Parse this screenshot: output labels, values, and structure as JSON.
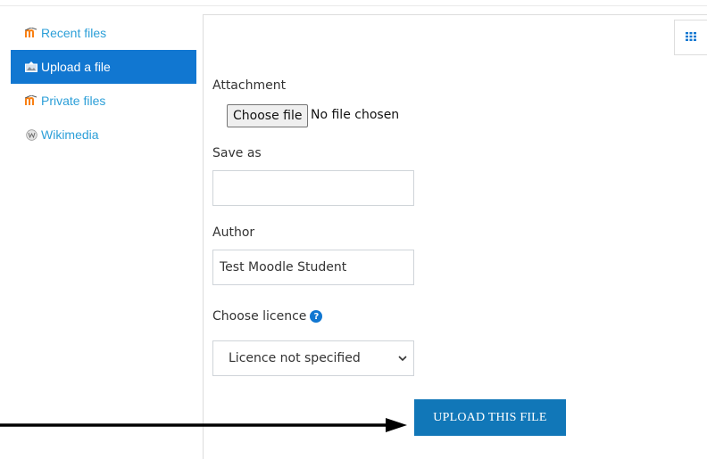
{
  "sidebar": {
    "items": [
      {
        "label": "Recent files",
        "icon": "moodle-icon",
        "active": false
      },
      {
        "label": "Upload a file",
        "icon": "upload-icon",
        "active": true
      },
      {
        "label": "Private files",
        "icon": "moodle-icon",
        "active": false
      },
      {
        "label": "Wikimedia",
        "icon": "wikimedia-icon",
        "active": false
      }
    ]
  },
  "form": {
    "attachment_label": "Attachment",
    "choose_file_label": "Choose file",
    "no_file_text": "No file chosen",
    "save_as_label": "Save as",
    "save_as_value": "",
    "author_label": "Author",
    "author_value": "Test Moodle Student",
    "licence_label": "Choose licence",
    "help_glyph": "?",
    "licence_selected": "Licence not specified",
    "upload_button": "UPLOAD THIS FILE"
  },
  "colors": {
    "accent": "#1177d1",
    "link": "#2c9fd8",
    "upload_button": "#1177b8",
    "moodle_orange": "#f98012"
  }
}
